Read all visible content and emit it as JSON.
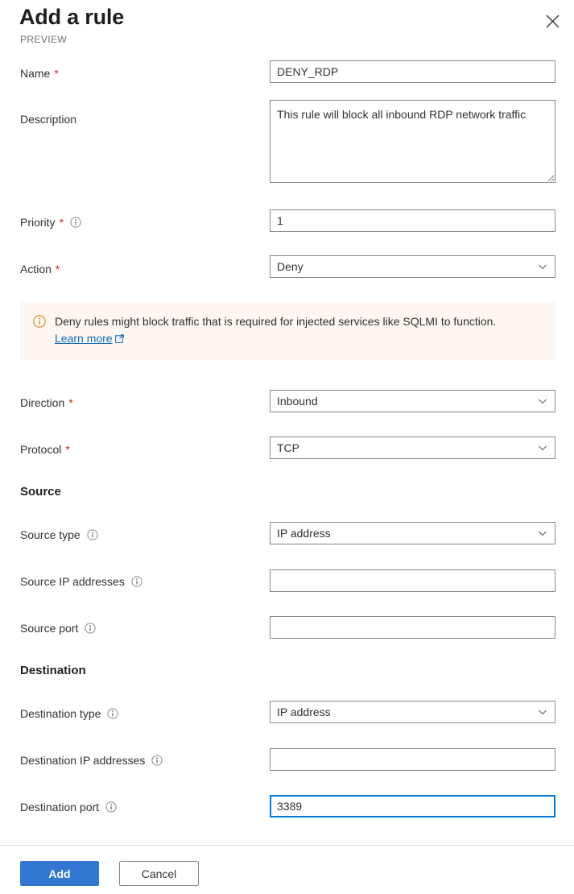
{
  "header": {
    "title": "Add a rule",
    "subtitle": "PREVIEW",
    "close_label": "Close"
  },
  "fields": {
    "name": {
      "label": "Name",
      "required": "*",
      "value": "DENY_RDP",
      "placeholder": ""
    },
    "description": {
      "label": "Description",
      "value": "This rule will block all inbound RDP network traffic",
      "placeholder": ""
    },
    "priority": {
      "label": "Priority",
      "required": "*",
      "value": "1",
      "placeholder": ""
    },
    "action": {
      "label": "Action",
      "required": "*",
      "value": "Deny"
    },
    "direction": {
      "label": "Direction",
      "required": "*",
      "value": "Inbound"
    },
    "protocol": {
      "label": "Protocol",
      "required": "*",
      "value": "TCP"
    },
    "source_type": {
      "label": "Source type",
      "value": "IP address"
    },
    "source_ip": {
      "label": "Source IP addresses",
      "value": "",
      "placeholder": ""
    },
    "source_port": {
      "label": "Source port",
      "value": "",
      "placeholder": ""
    },
    "destination_type": {
      "label": "Destination type",
      "value": "IP address"
    },
    "destination_ip": {
      "label": "Destination IP addresses",
      "value": "",
      "placeholder": ""
    },
    "destination_port": {
      "label": "Destination port",
      "value": "3389",
      "placeholder": ""
    }
  },
  "sections": {
    "source": "Source",
    "destination": "Destination"
  },
  "banner": {
    "icon": "info-icon",
    "text": "Deny rules might block traffic that is required for injected services like SQLMI to function.",
    "link_text": "Learn more",
    "link_icon": "external-link-icon",
    "background": "#fdf6f1",
    "icon_color": "#d68021"
  },
  "footer": {
    "add_label": "Add",
    "cancel_label": "Cancel"
  },
  "colors": {
    "accent": "#0078d4",
    "primary_button": "#3277d1",
    "required_asterisk": "#c42b1c",
    "link": "#0f6cbd",
    "border": "#8a8886"
  }
}
